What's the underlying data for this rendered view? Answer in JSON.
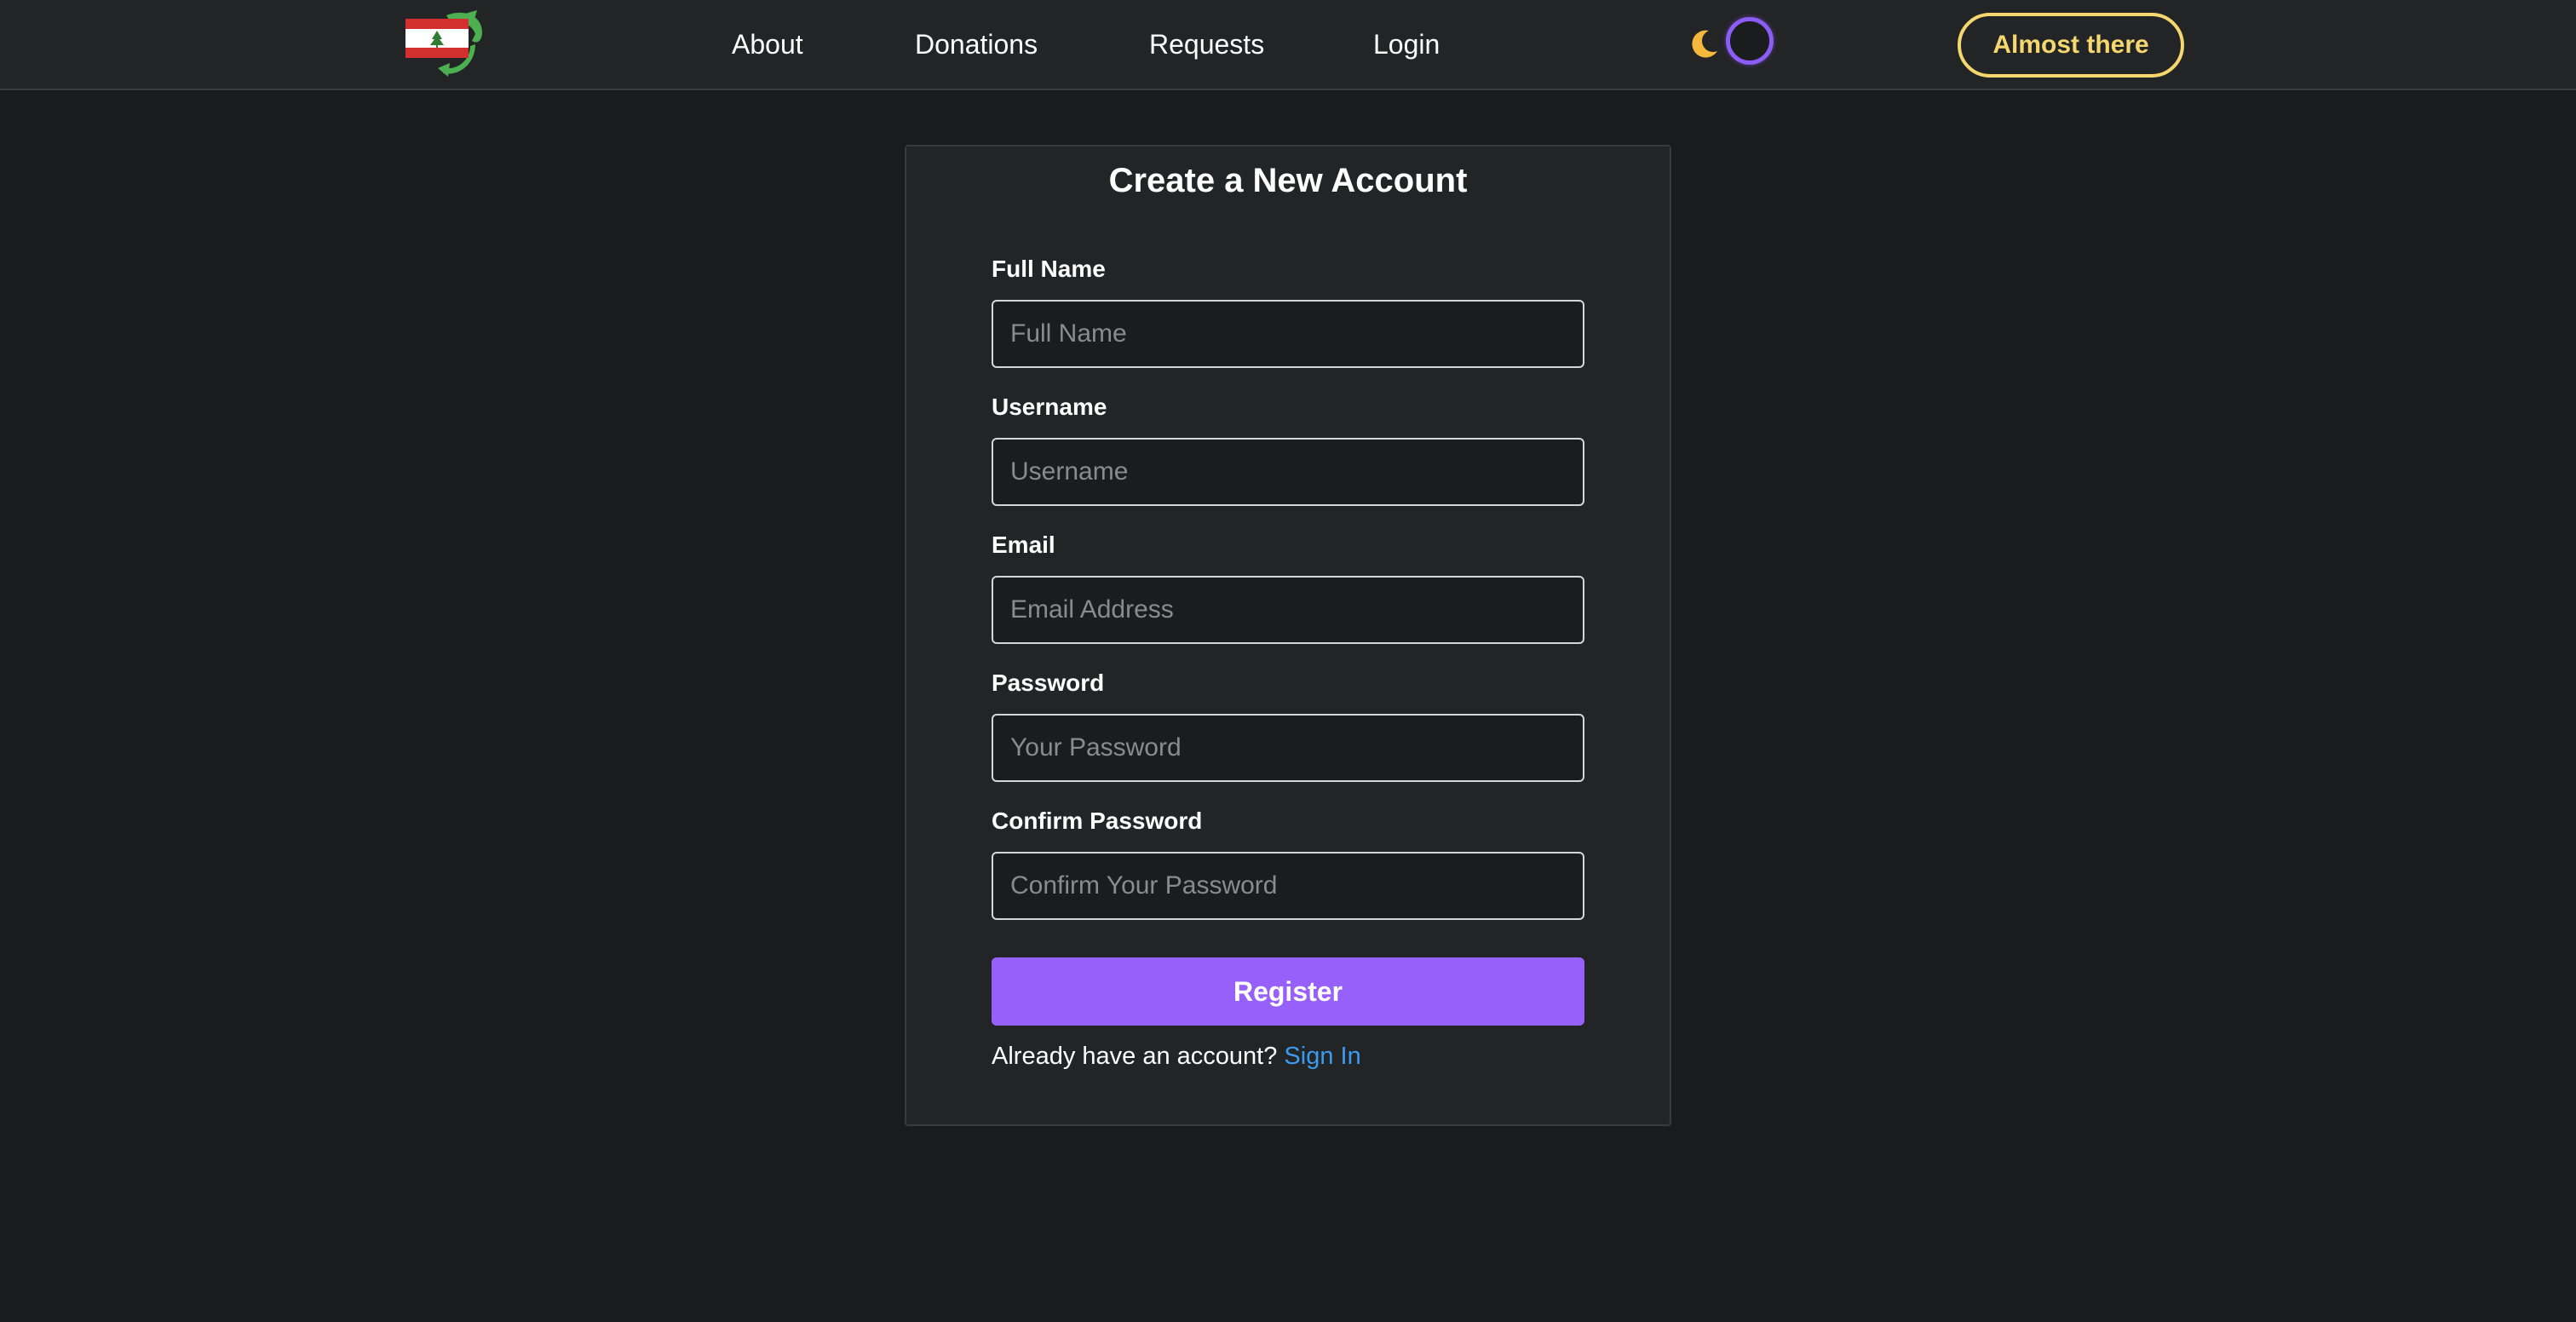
{
  "navbar": {
    "logo_icon": "lebanon-flag-recycle-logo",
    "links": [
      {
        "label": "About"
      },
      {
        "label": "Donations"
      },
      {
        "label": "Requests"
      },
      {
        "label": "Login"
      }
    ],
    "theme_toggle": {
      "icon": "moon-icon",
      "state": "dark"
    },
    "cta_label": "Almost there"
  },
  "form": {
    "title": "Create a New Account",
    "fields": [
      {
        "label": "Full Name",
        "placeholder": "Full Name",
        "value": ""
      },
      {
        "label": "Username",
        "placeholder": "Username",
        "value": ""
      },
      {
        "label": "Email",
        "placeholder": "Email Address",
        "value": ""
      },
      {
        "label": "Password",
        "placeholder": "Your Password",
        "value": ""
      },
      {
        "label": "Confirm Password",
        "placeholder": "Confirm Your Password",
        "value": ""
      }
    ],
    "submit_label": "Register",
    "footer_text": "Already have an account?",
    "footer_link": "Sign In"
  },
  "colors": {
    "background": "#1a1b1d",
    "surface": "#232426",
    "accent": "#9760fb",
    "cta": "#f5d76e",
    "link": "#3a9bf0"
  }
}
